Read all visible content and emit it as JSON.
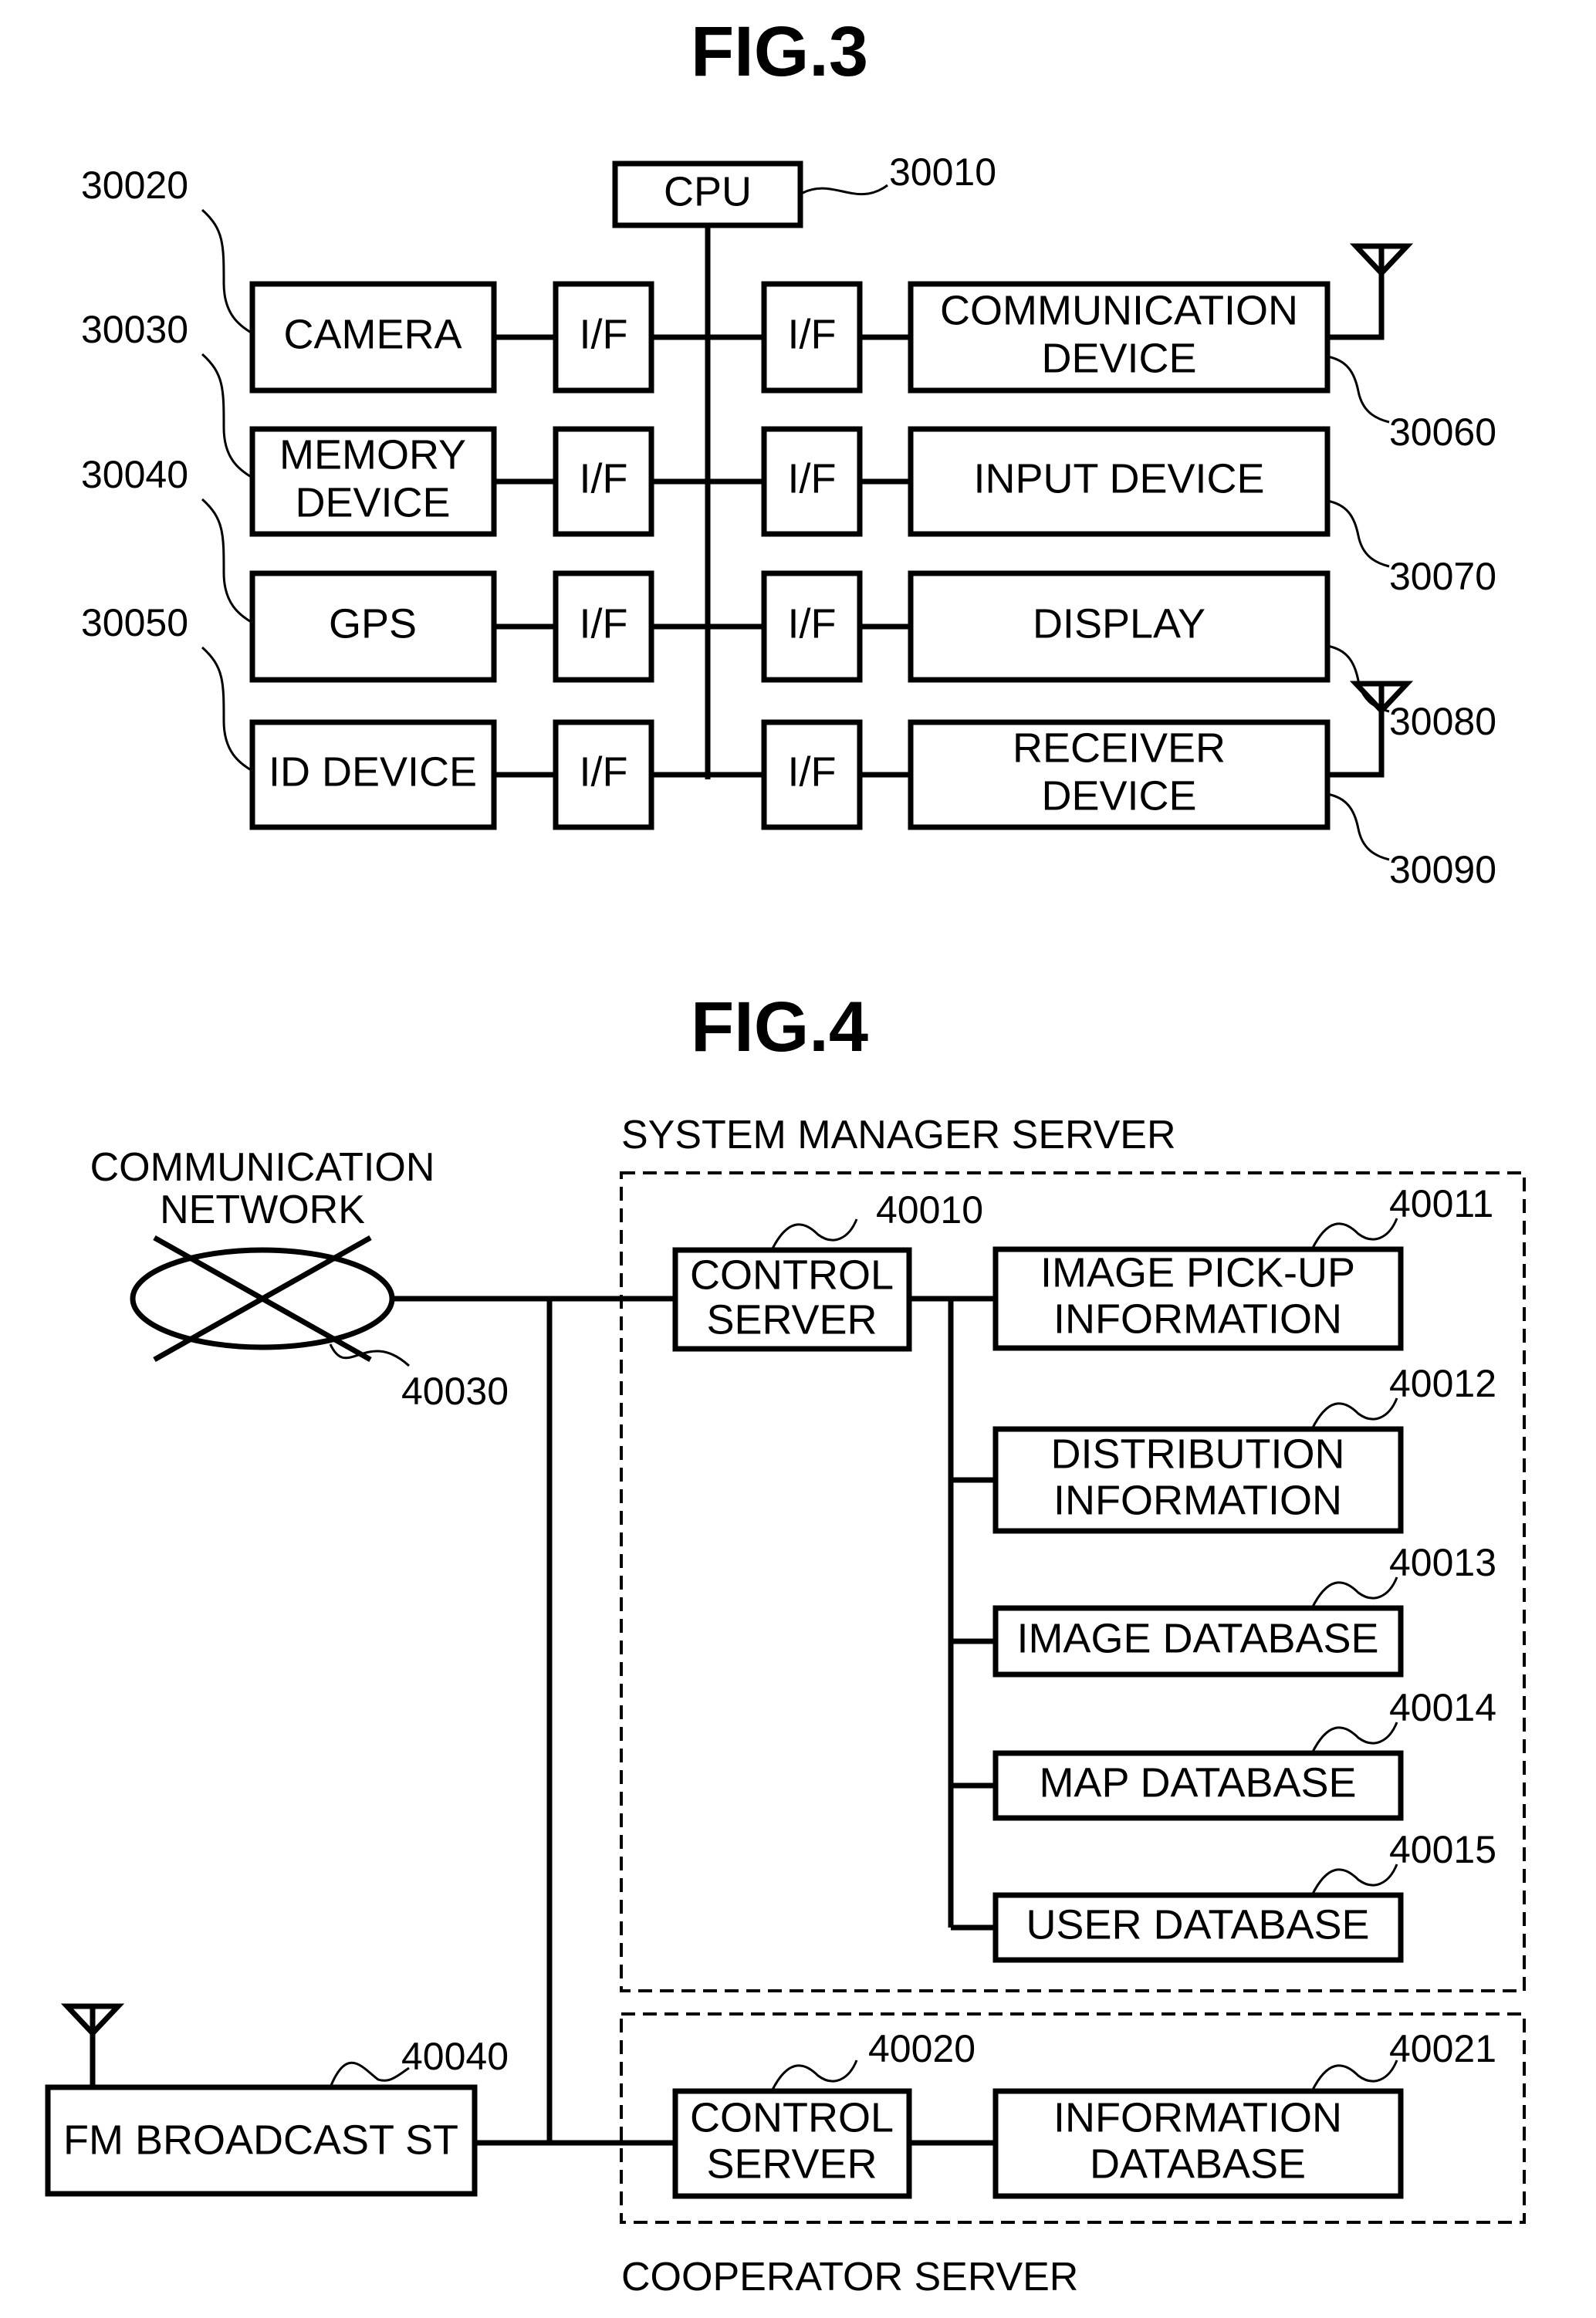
{
  "fig3": {
    "title": "FIG.3",
    "cpu": {
      "label": "CPU",
      "ref": "30010"
    },
    "interface_label": "I/F",
    "left_devices": [
      {
        "lines": [
          "CAMERA"
        ],
        "ref": "30020"
      },
      {
        "lines": [
          "MEMORY",
          "DEVICE"
        ],
        "ref": "30030"
      },
      {
        "lines": [
          "GPS"
        ],
        "ref": "30040"
      },
      {
        "lines": [
          "ID DEVICE"
        ],
        "ref": "30050"
      }
    ],
    "right_devices": [
      {
        "lines": [
          "COMMUNICATION",
          "DEVICE"
        ],
        "ref": "30060",
        "antenna": true
      },
      {
        "lines": [
          "INPUT DEVICE"
        ],
        "ref": "30070",
        "antenna": false
      },
      {
        "lines": [
          "DISPLAY"
        ],
        "ref": "30080",
        "antenna": false
      },
      {
        "lines": [
          "RECEIVER",
          "DEVICE"
        ],
        "ref": "30090",
        "antenna": true
      }
    ]
  },
  "fig4": {
    "title": "FIG.4",
    "network": {
      "lines": [
        "COMMUNICATION",
        "NETWORK"
      ],
      "ref": "40030"
    },
    "fm_station": {
      "label": "FM BROADCAST ST",
      "ref": "40040"
    },
    "system_manager": {
      "label": "SYSTEM MANAGER SERVER",
      "control": {
        "lines": [
          "CONTROL",
          "SERVER"
        ],
        "ref": "40010"
      },
      "items": [
        {
          "lines": [
            "IMAGE PICK-UP",
            "INFORMATION"
          ],
          "ref": "40011"
        },
        {
          "lines": [
            "DISTRIBUTION",
            "INFORMATION"
          ],
          "ref": "40012"
        },
        {
          "lines": [
            "IMAGE DATABASE"
          ],
          "ref": "40013"
        },
        {
          "lines": [
            "MAP DATABASE"
          ],
          "ref": "40014"
        },
        {
          "lines": [
            "USER DATABASE"
          ],
          "ref": "40015"
        }
      ]
    },
    "cooperator": {
      "label": "COOPERATOR SERVER",
      "control": {
        "lines": [
          "CONTROL",
          "SERVER"
        ],
        "ref": "40020"
      },
      "database": {
        "lines": [
          "INFORMATION",
          "DATABASE"
        ],
        "ref": "40021"
      }
    }
  }
}
